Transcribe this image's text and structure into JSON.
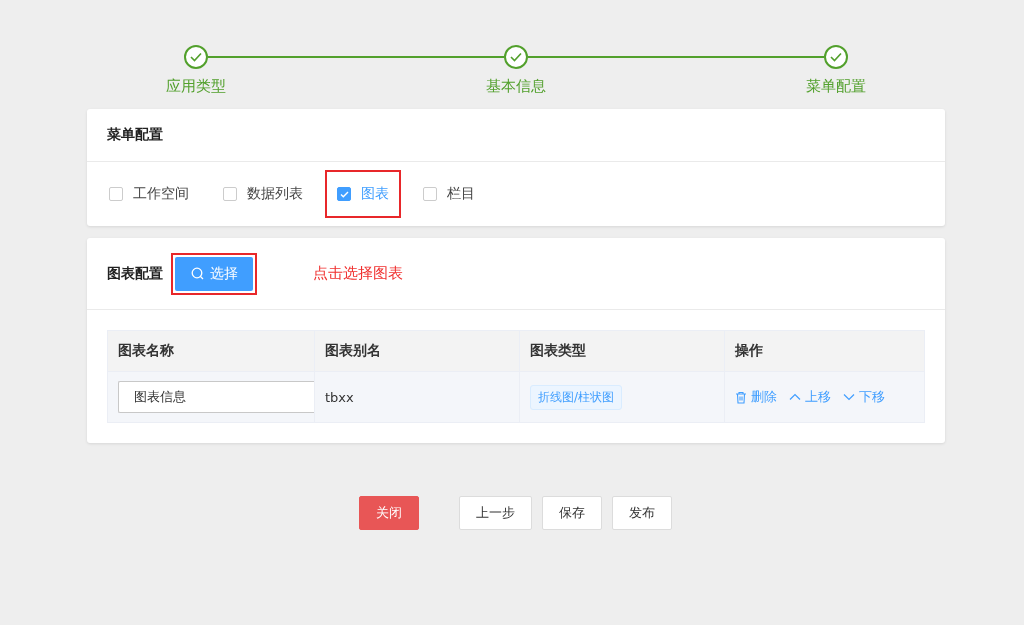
{
  "steps": [
    {
      "label": "应用类型",
      "done": true
    },
    {
      "label": "基本信息",
      "done": true
    },
    {
      "label": "菜单配置",
      "done": true
    }
  ],
  "menu_config": {
    "title": "菜单配置",
    "options": [
      {
        "label": "工作空间",
        "checked": false,
        "highlighted": false
      },
      {
        "label": "数据列表",
        "checked": false,
        "highlighted": false
      },
      {
        "label": "图表",
        "checked": true,
        "highlighted": true
      },
      {
        "label": "栏目",
        "checked": false,
        "highlighted": false
      }
    ]
  },
  "chart_config": {
    "title": "图表配置",
    "select_button": {
      "label": "选择",
      "highlighted": true
    },
    "annotation": "点击选择图表",
    "table": {
      "columns": [
        "图表名称",
        "图表别名",
        "图表类型",
        "操作"
      ],
      "rows": [
        {
          "name": "图表信息",
          "alias": "tbxx",
          "type": "折线图/柱状图",
          "actions": [
            {
              "kind": "delete",
              "label": "删除"
            },
            {
              "kind": "up",
              "label": "上移"
            },
            {
              "kind": "down",
              "label": "下移"
            }
          ]
        }
      ]
    }
  },
  "buttons": [
    {
      "label": "关闭",
      "kind": "danger"
    },
    {
      "label": "上一步",
      "kind": "default"
    },
    {
      "label": "保存",
      "kind": "default"
    },
    {
      "label": "发布",
      "kind": "default"
    }
  ]
}
